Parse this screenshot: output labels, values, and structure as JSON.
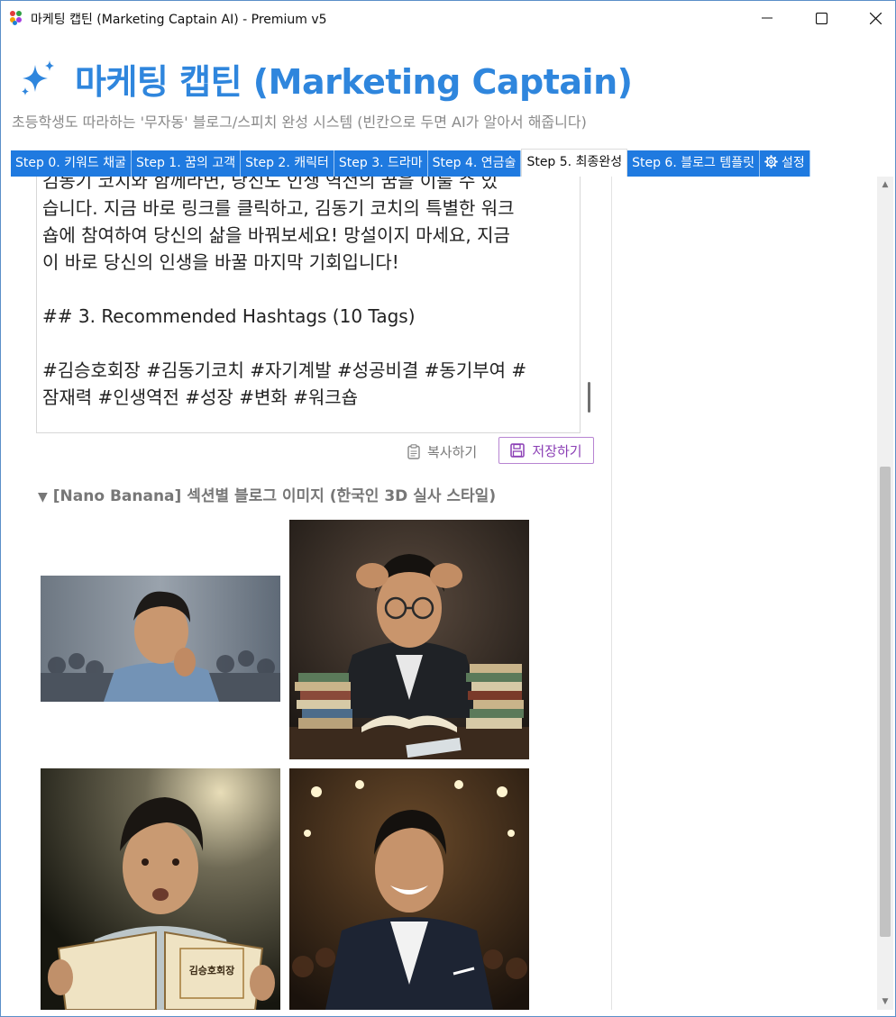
{
  "window": {
    "title": "마케팅 캡틴 (Marketing Captain AI) - Premium v5",
    "minimize": "—",
    "maximize": "☐",
    "close": "✕"
  },
  "header": {
    "title": "마케팅 캡틴 (Marketing Captain)",
    "subtitle": "초등학생도 따라하는 '무자동' 블로그/스피치 완성 시스템 (빈칸으로 두면 AI가 알아서 해줍니다)"
  },
  "tabs": [
    {
      "label": "Step 0. 키워드 채굴"
    },
    {
      "label": "Step 1. 꿈의 고객"
    },
    {
      "label": "Step 2. 캐릭터"
    },
    {
      "label": "Step 3. 드라마"
    },
    {
      "label": "Step 4. 연금술"
    },
    {
      "label": "Step 5. 최종완성"
    },
    {
      "label": "Step 6. 블로그 템플릿"
    },
    {
      "label": "설정"
    }
  ],
  "result_text": {
    "line_partial": "김동기 코치와 함께라면, 당신도 인생 역전의 꿈을 이룰 수 있",
    "line1": "습니다. 지금 바로 링크를 클릭하고, 김동기 코치의 특별한 워크",
    "line2": "숍에 참여하여 당신의 삶을 바꿔보세요! 망설이지 마세요, 지금",
    "line3": "이 바로 당신의 인생을 바꿀 마지막 기회입니다!",
    "hashtag_heading": "## 3. Recommended Hashtags (10 Tags)",
    "hashtags_line1": "#김승호회장 #김동기코치 #자기계발 #성공비결 #동기부여 #",
    "hashtags_line2": "잠재력 #인생역전 #성장 #변화 #워크숍"
  },
  "actions": {
    "copy_label": "복사하기",
    "save_label": "저장하기"
  },
  "images_section": {
    "title": "[Nano Banana] 섹션별 블로그 이미지 (한국인 3D 실사 스타일)",
    "book_text": "김승호회장"
  },
  "colors": {
    "accent": "#2f86dd",
    "tab_blue": "#1f7ae0",
    "save_purple": "#8b3fb5"
  }
}
